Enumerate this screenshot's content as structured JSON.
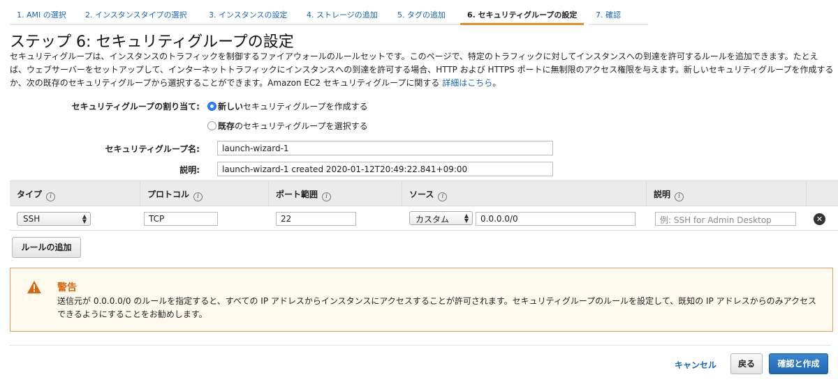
{
  "tabs": [
    {
      "label": "1. AMI の選択"
    },
    {
      "label": "2. インスタンスタイプの選択"
    },
    {
      "label": "3. インスタンスの設定"
    },
    {
      "label": "4. ストレージの追加"
    },
    {
      "label": "5. タグの追加"
    },
    {
      "label": "6. セキュリティグループの設定"
    },
    {
      "label": "7. 確認"
    }
  ],
  "page": {
    "title": "ステップ 6: セキュリティグループの設定",
    "description": "セキュリティグループは、インスタンスのトラフィックを制御するファイアウォールのルールセットです。このページで、特定のトラフィックに対してインスタンスへの到達を許可するルールを追加できます。たとえば、ウェブサーバーをセットアップして、インターネットトラフィックにインスタンスへの到達を許可する場合、HTTP および HTTPS ポートに無制限のアクセス権限を与えます。新しいセキュリティグループを作成するか、次の既存のセキュリティグループから選択することができます。Amazon EC2 セキュリティグループに関する ",
    "details_link": "詳細はこちら",
    "description_end": "。"
  },
  "assign": {
    "label": "セキュリティグループの割り当て:",
    "option_new_bold": "新しい",
    "option_new_rest": "セキュリティグループを作成する",
    "option_existing_bold": "既存",
    "option_existing_rest": "のセキュリティグループを選択する",
    "selected": "new"
  },
  "fields": {
    "name_label": "セキュリティグループ名:",
    "name_value": "launch-wizard-1",
    "desc_label": "説明:",
    "desc_value": "launch-wizard-1 created 2020-01-12T20:49:22.841+09:00"
  },
  "table": {
    "headers": [
      {
        "label": "タイプ"
      },
      {
        "label": "プロトコル"
      },
      {
        "label": "ポート範囲"
      },
      {
        "label": "ソース"
      },
      {
        "label": "説明"
      }
    ],
    "info_glyph": "i",
    "rows": [
      {
        "type": "SSH",
        "protocol": "TCP",
        "port": "22",
        "source_mode": "カスタム",
        "source_value": "0.0.0.0/0",
        "description_placeholder": "例: SSH for Admin Desktop"
      }
    ]
  },
  "add_rule_label": "ルールの追加",
  "warning": {
    "title": "警告",
    "text": "送信元が 0.0.0.0/0 のルールを指定すると、すべての IP アドレスからインスタンスにアクセスすることが許可されます。セキュリティグループのルールを設定して、既知の IP アドレスからのみアクセスできるようにすることをお勧めします。",
    "color": "#d86613"
  },
  "footer": {
    "cancel": "キャンセル",
    "back": "戻る",
    "review_launch": "確認と作成"
  },
  "colors": {
    "link": "#1266c2",
    "active_tab": "#ec8b1c",
    "primary_button": "#1f67b3"
  }
}
